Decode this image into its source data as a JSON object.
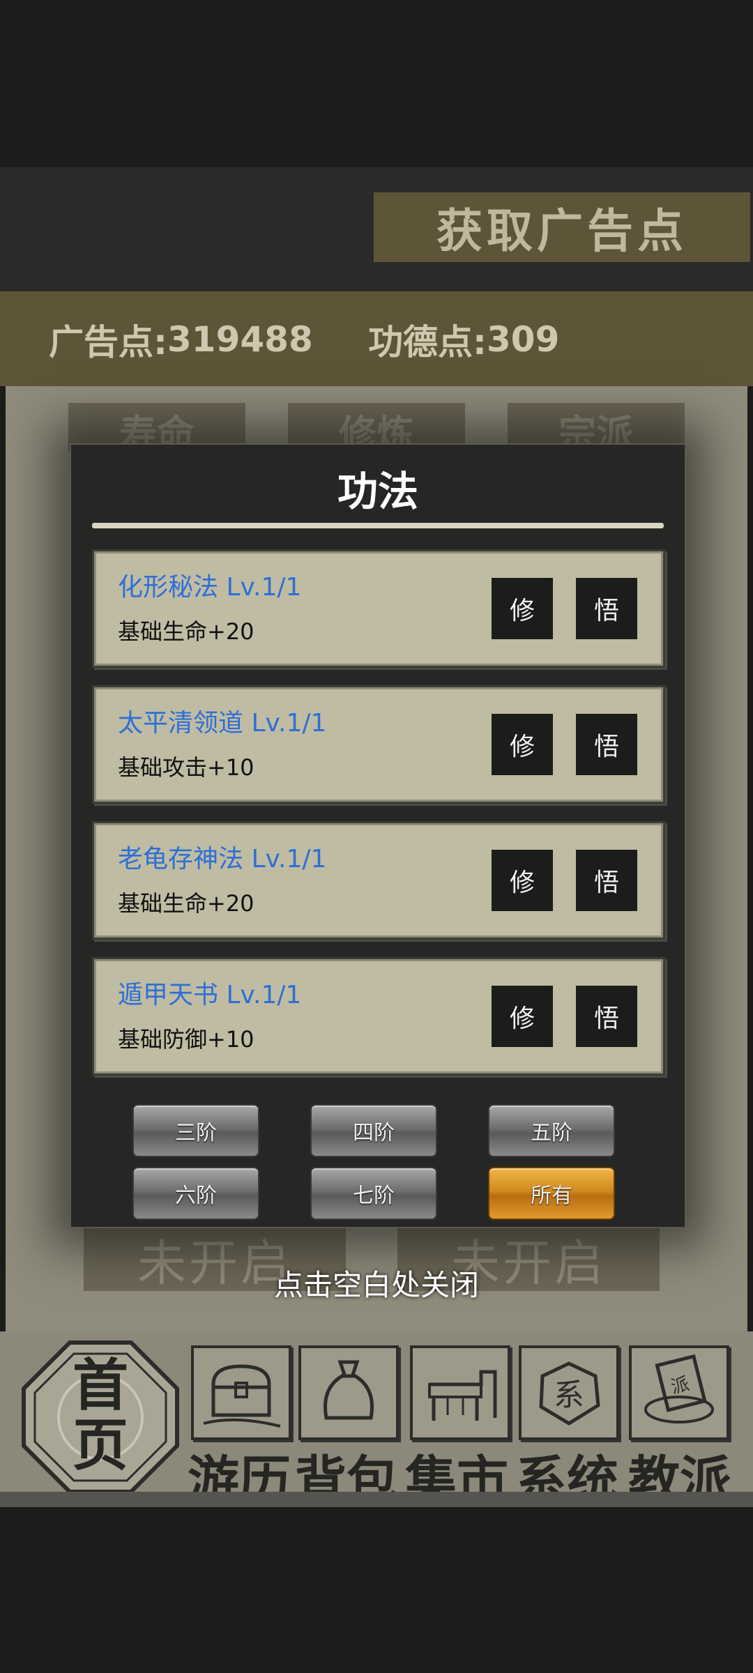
{
  "header": {
    "ad_button_label": "获取广告点"
  },
  "stats": {
    "ad_points_label": "广告点:",
    "ad_points_value": "319488",
    "merit_points_label": "功德点:",
    "merit_points_value": "309"
  },
  "background": {
    "tabs": [
      "寿命",
      "修炼",
      "宗派"
    ],
    "locked_1": "未开启",
    "locked_2": "未开启"
  },
  "modal": {
    "title": "功法",
    "skills": [
      {
        "name": "化形秘法 Lv.1/1",
        "effect": "基础生命+20",
        "btn_cultivate": "修",
        "btn_comprehend": "悟"
      },
      {
        "name": "太平清领道 Lv.1/1",
        "effect": "基础攻击+10",
        "btn_cultivate": "修",
        "btn_comprehend": "悟"
      },
      {
        "name": "老龟存神法 Lv.1/1",
        "effect": "基础生命+20",
        "btn_cultivate": "修",
        "btn_comprehend": "悟"
      },
      {
        "name": "遁甲天书 Lv.1/1",
        "effect": "基础防御+10",
        "btn_cultivate": "修",
        "btn_comprehend": "悟"
      }
    ],
    "tiers": [
      "三阶",
      "四阶",
      "五阶",
      "六阶",
      "七阶",
      "所有"
    ],
    "active_tier": "所有"
  },
  "close_hint": "点击空白处关闭",
  "nav": {
    "home": "首页",
    "items": [
      {
        "label": "游历",
        "icon": "treasure-chest-icon"
      },
      {
        "label": "背包",
        "icon": "bag-icon"
      },
      {
        "label": "集市",
        "icon": "market-stall-icon"
      },
      {
        "label": "系统",
        "icon": "system-seal-icon"
      },
      {
        "label": "教派",
        "icon": "sect-book-icon"
      }
    ]
  },
  "colors": {
    "skill_name": "#2e6fd6",
    "active_tier": "#d08a1e",
    "panel": "#262624",
    "card": "#bfbca3"
  }
}
